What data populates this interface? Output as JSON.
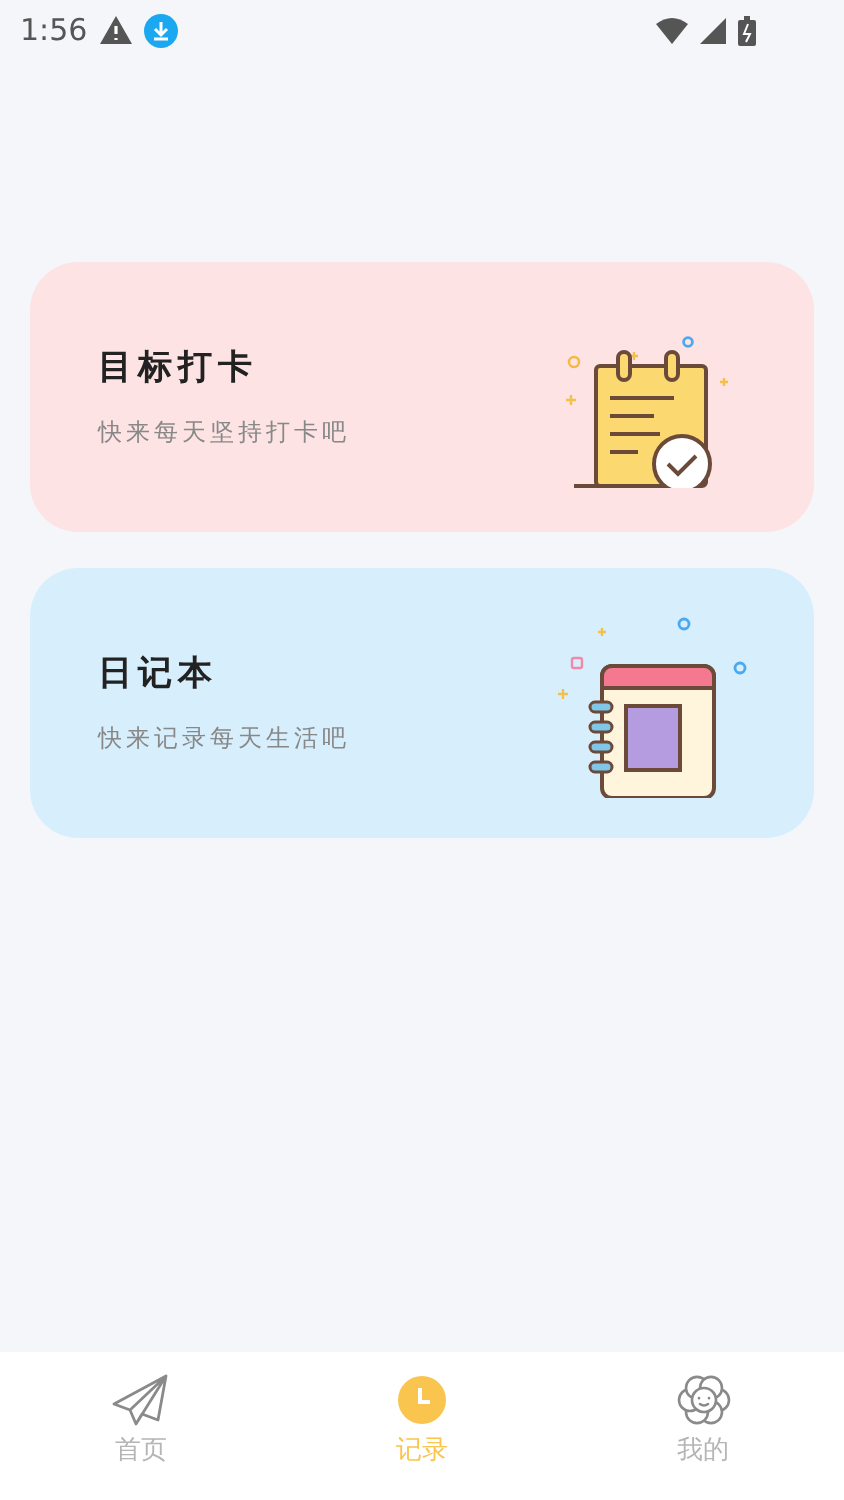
{
  "status_bar": {
    "time": "1:56"
  },
  "cards": [
    {
      "kind": "checkin",
      "title": "目标打卡",
      "subtitle": "快来每天坚持打卡吧",
      "color": "#fde3e3"
    },
    {
      "kind": "diary",
      "title": "日记本",
      "subtitle": "快来记录每天生活吧",
      "color": "#d7effd"
    }
  ],
  "tabs": [
    {
      "kind": "home",
      "label": "首页",
      "selected": false
    },
    {
      "kind": "record",
      "label": "记录",
      "selected": true
    },
    {
      "kind": "mine",
      "label": "我的",
      "selected": false
    }
  ]
}
